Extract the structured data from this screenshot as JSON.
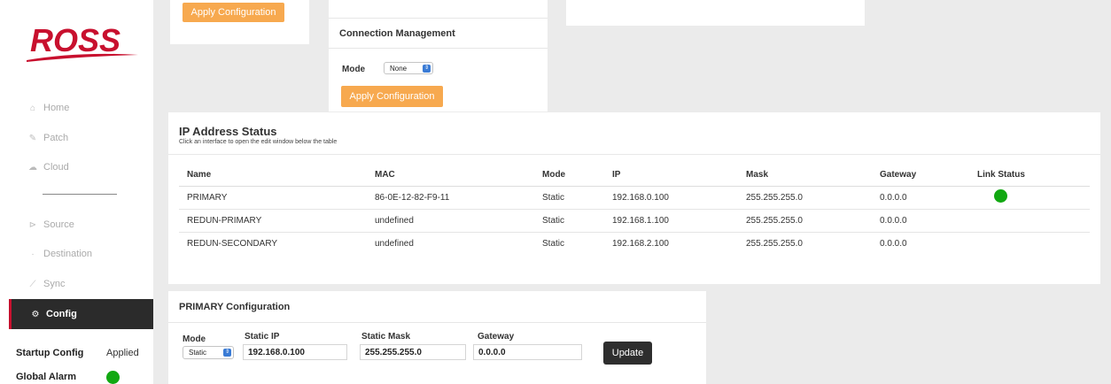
{
  "brand": {
    "logo_text": "ROSS",
    "color": "#c8102e"
  },
  "sidebar": {
    "nav": [
      {
        "label": "Home",
        "icon": "home-icon"
      },
      {
        "label": "Patch",
        "icon": "edit-icon"
      },
      {
        "label": "Cloud",
        "icon": "cloud-icon"
      },
      {
        "label": "Source",
        "icon": "source-icon"
      },
      {
        "label": "Destination",
        "icon": "destination-icon"
      },
      {
        "label": "Sync",
        "icon": "sync-icon"
      },
      {
        "label": "Config",
        "icon": "gear-icon",
        "active": true
      }
    ],
    "startup_config": {
      "label": "Startup Config",
      "value": "Applied"
    },
    "global_alarm": {
      "label": "Global Alarm",
      "status": "ok",
      "color": "#12a812"
    }
  },
  "top_left_panel": {
    "apply_label": "Apply Configuration"
  },
  "connection_panel": {
    "title": "Connection Management",
    "mode_label": "Mode",
    "mode_value": "None",
    "apply_label": "Apply Configuration"
  },
  "ip_status": {
    "title": "IP Address Status",
    "subtitle": "Click an interface to open the edit window below the table",
    "columns": [
      "Name",
      "MAC",
      "Mode",
      "IP",
      "Mask",
      "Gateway",
      "Link Status"
    ],
    "rows": [
      {
        "name": "PRIMARY",
        "mac": "86-0E-12-82-F9-11",
        "mode": "Static",
        "ip": "192.168.0.100",
        "mask": "255.255.255.0",
        "gateway": "0.0.0.0",
        "link": "up"
      },
      {
        "name": "REDUN-PRIMARY",
        "mac": "undefined",
        "mode": "Static",
        "ip": "192.168.1.100",
        "mask": "255.255.255.0",
        "gateway": "0.0.0.0",
        "link": ""
      },
      {
        "name": "REDUN-SECONDARY",
        "mac": "undefined",
        "mode": "Static",
        "ip": "192.168.2.100",
        "mask": "255.255.255.0",
        "gateway": "0.0.0.0",
        "link": ""
      }
    ]
  },
  "primary_config": {
    "title": "PRIMARY Configuration",
    "mode_label": "Mode",
    "mode_value": "Static",
    "static_ip_label": "Static IP",
    "static_ip_value": "192.168.0.100",
    "static_mask_label": "Static Mask",
    "static_mask_value": "255.255.255.0",
    "gateway_label": "Gateway",
    "gateway_value": "0.0.0.0",
    "update_label": "Update"
  },
  "colors": {
    "accent_orange": "#f7a94f",
    "link_up": "#12a812",
    "dark_button": "#2e2e2e"
  }
}
